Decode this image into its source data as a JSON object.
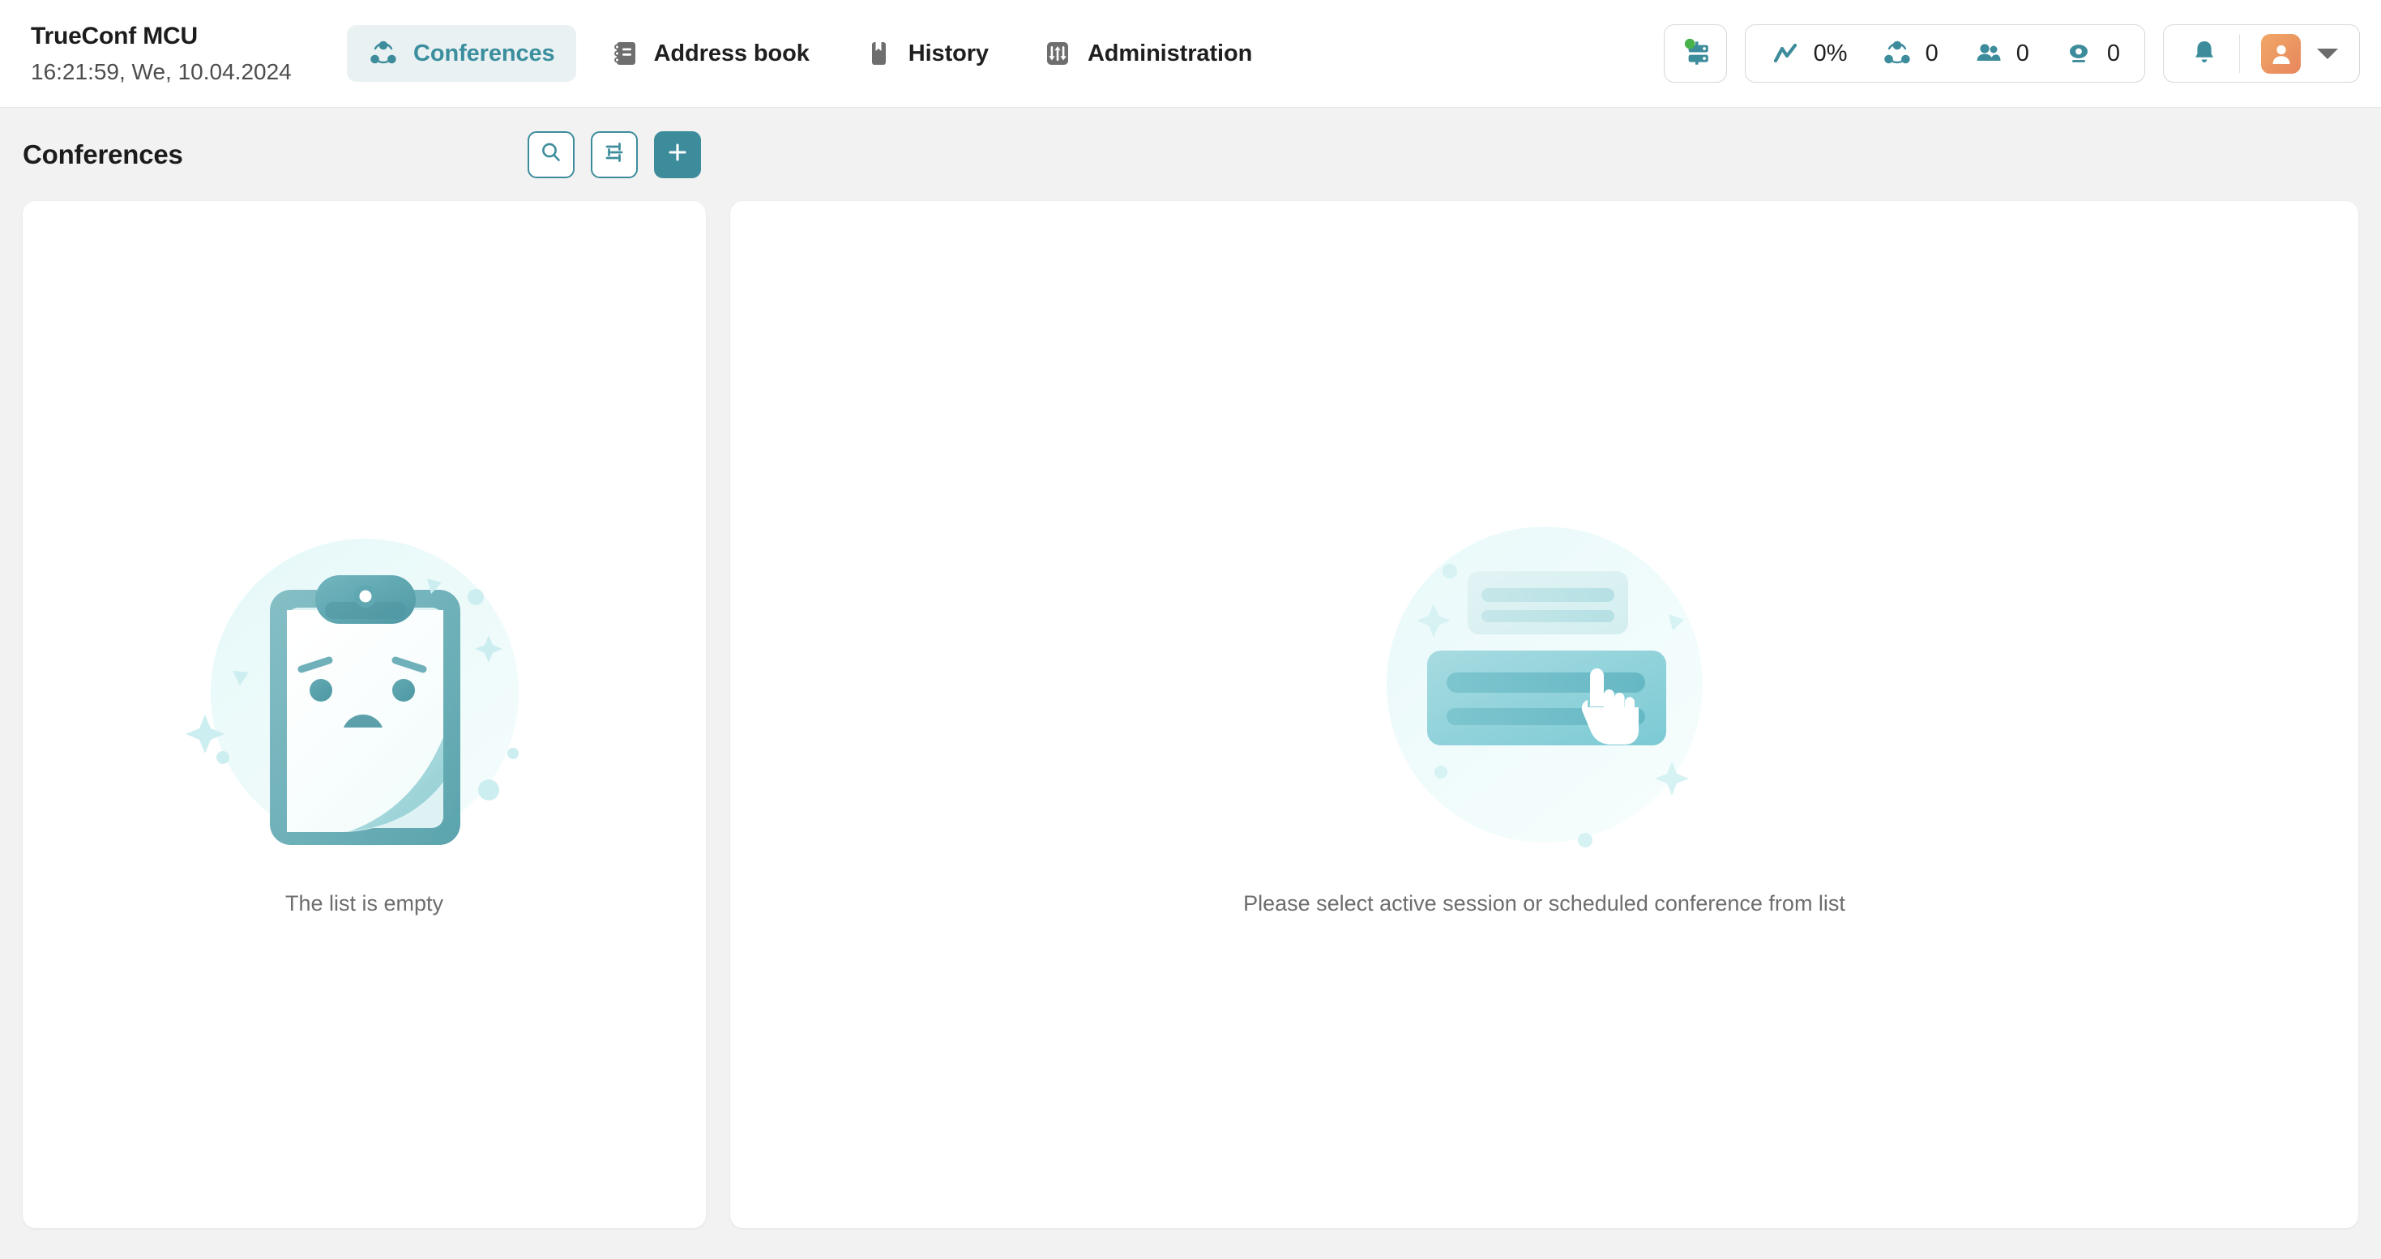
{
  "header": {
    "brand_title": "TrueConf MCU",
    "clock": "16:21:59, We, 10.04.2024",
    "nav_tabs": [
      {
        "label": "Conferences",
        "icon": "conference-network-icon",
        "active": true
      },
      {
        "label": "Address book",
        "icon": "address-book-icon",
        "active": false
      },
      {
        "label": "History",
        "icon": "bookmark-icon",
        "active": false
      },
      {
        "label": "Administration",
        "icon": "sliders-icon",
        "active": false
      }
    ],
    "server_status": {
      "icon": "server-rack-icon",
      "indicator": "online",
      "indicator_color": "#49b34a"
    },
    "stats": [
      {
        "name": "cpu-load",
        "icon": "trend-line-icon",
        "value": "0%"
      },
      {
        "name": "active-conferences",
        "icon": "conference-network-icon",
        "value": "0"
      },
      {
        "name": "participants",
        "icon": "users-icon",
        "value": "0"
      },
      {
        "name": "endpoints",
        "icon": "webcam-icon",
        "value": "0"
      }
    ],
    "notifications_icon": "bell-icon",
    "avatar_icon": "user-avatar-icon",
    "user_menu_icon": "caret-down-icon"
  },
  "conferences_panel": {
    "title": "Conferences",
    "buttons": [
      {
        "name": "search-button",
        "icon": "search-icon",
        "style": "outline"
      },
      {
        "name": "filter-button",
        "icon": "sliders-icon",
        "style": "outline"
      },
      {
        "name": "create-conference-button",
        "icon": "plus-icon",
        "style": "primary"
      }
    ],
    "empty_state": {
      "illustration": "sad-clipboard-illustration",
      "message": "The list is empty"
    }
  },
  "detail_panel": {
    "empty_state": {
      "illustration": "select-list-item-illustration",
      "message": "Please select active session or scheduled conference from list"
    }
  },
  "theme": {
    "accent": "#3d8c9c",
    "accent_light": "#e9f1f2",
    "page_background": "#f2f2f2",
    "card_background": "#ffffff",
    "text_primary": "#1c1c1c",
    "text_muted": "#6d6d6d",
    "avatar_gradient_from": "#f0a868",
    "avatar_gradient_to": "#e8865c"
  }
}
